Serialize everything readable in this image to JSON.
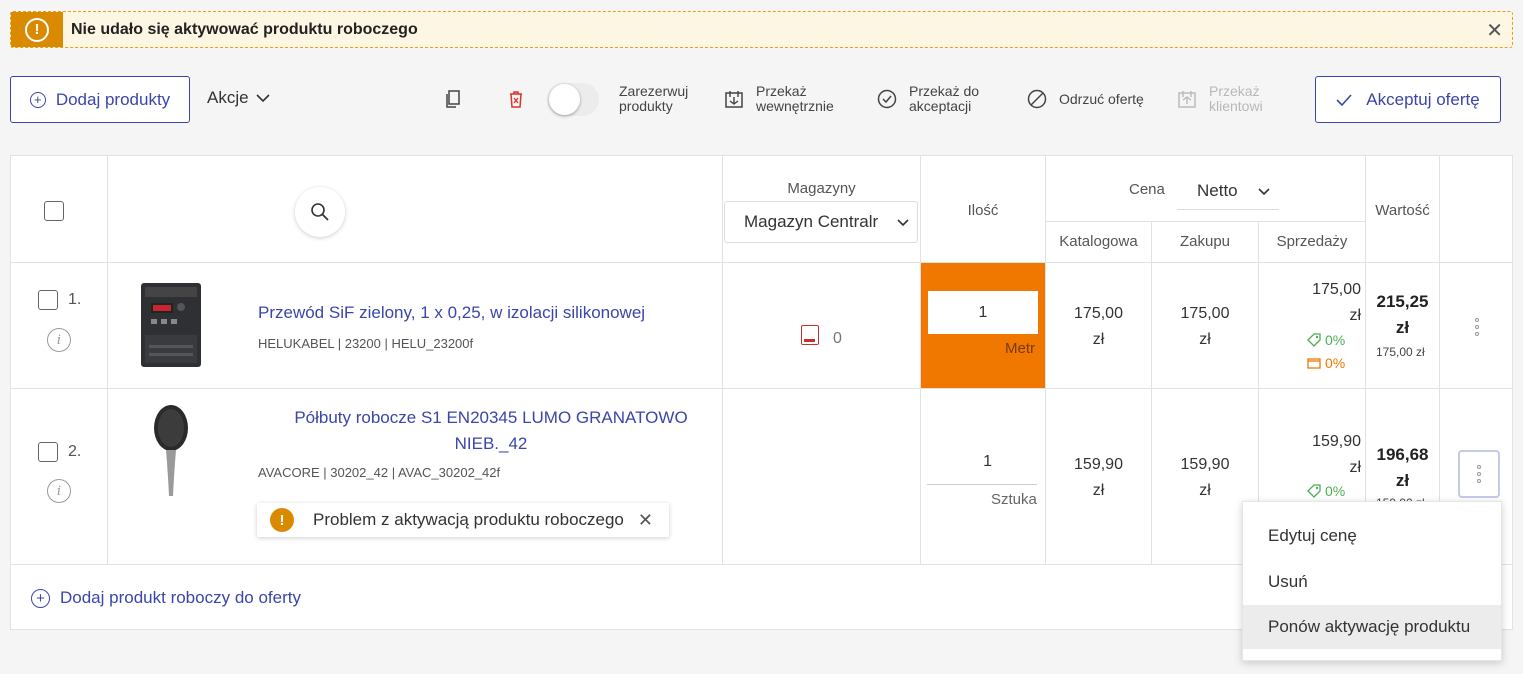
{
  "alert": {
    "message": "Nie udało się aktywować produktu roboczego",
    "icon": "exclamation-icon",
    "close": "✕"
  },
  "toolbar": {
    "add_products": "Dodaj produkty",
    "actions": "Akcje",
    "reserve_line1": "Zarezerwuj",
    "reserve_line2": "produkty",
    "transfer_internal_line1": "Przekaż",
    "transfer_internal_line2": "wewnętrznie",
    "transfer_accept_line1": "Przekaż do",
    "transfer_accept_line2": "akceptacji",
    "reject": "Odrzuć ofertę",
    "transfer_client_line1": "Przekaż",
    "transfer_client_line2": "klientowi",
    "accept": "Akceptuj ofertę"
  },
  "table": {
    "headers": {
      "warehouses": "Magazyny",
      "warehouse_selected": "Magazyn Centralr",
      "quantity": "Ilość",
      "price": "Cena",
      "price_mode": "Netto",
      "catalog": "Katalogowa",
      "purchase": "Zakupu",
      "sales": "Sprzedaży",
      "value": "Wartość"
    },
    "rows": [
      {
        "num": "1.",
        "name": "Przewód SiF zielony, 1 x 0,25, w izolacji silikonowej",
        "meta": "HELUKABEL | 23200 | HELU_23200f",
        "stock": "0",
        "qty": "1",
        "unit": "Metr",
        "catalog_1": "175,00",
        "catalog_2": "zł",
        "purchase_1": "175,00",
        "purchase_2": "zł",
        "sales_1": "175,00",
        "sales_2": "zł",
        "discount": "0%",
        "margin": "0%",
        "value_1": "215,25",
        "value_2": "zł",
        "value_sub": "175,00 zł"
      },
      {
        "num": "2.",
        "name_line1": "Półbuty robocze S1 EN20345 LUMO GRANATOWO",
        "name_line2": "NIEB._42",
        "meta": "AVACORE | 30202_42 | AVAC_30202_42f",
        "qty": "1",
        "unit": "Sztuka",
        "catalog_1": "159,90",
        "catalog_2": "zł",
        "purchase_1": "159,90",
        "purchase_2": "zł",
        "sales_1": "159,90",
        "sales_2": "zł",
        "discount": "0%",
        "value_1": "196,68",
        "value_2": "zł",
        "value_sub": "159,90 zł"
      }
    ],
    "add_draft": "Dodaj produkt roboczy do oferty"
  },
  "toast": {
    "message": "Problem z aktywacją produktu roboczego",
    "close": "✕"
  },
  "menu": {
    "items": [
      "Edytuj cenę",
      "Usuń",
      "Ponów aktywację produktu"
    ]
  },
  "colors": {
    "accent": "#3a46a8",
    "warning": "#d98a00",
    "qty_highlight": "#f07800",
    "discount": "#4caf50",
    "margin": "#f07800"
  }
}
